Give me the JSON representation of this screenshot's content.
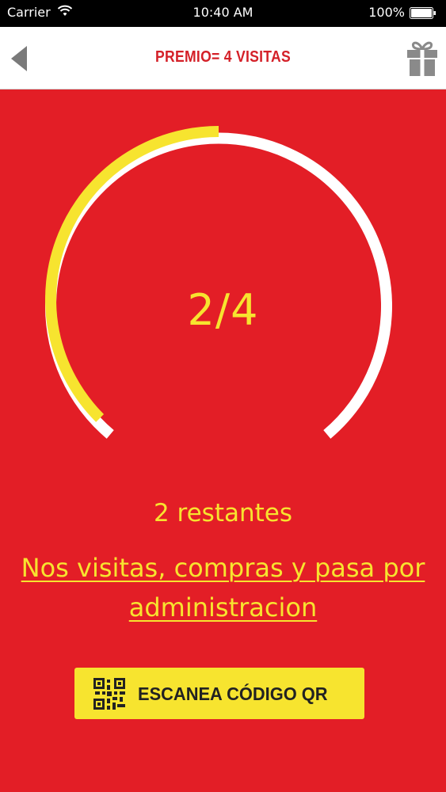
{
  "status_bar": {
    "carrier": "Carrier",
    "time": "10:40 AM",
    "battery": "100%"
  },
  "header": {
    "title": "PREMIO= 4 VISITAS",
    "back_icon": "back-arrow-icon",
    "gift_icon": "gift-icon"
  },
  "progress": {
    "label": "2/4",
    "completed": 2,
    "total": 4,
    "fraction": 0.5,
    "remaining_text": "2 restantes",
    "fill_color": "#f7e42f",
    "track_color": "#ffffff"
  },
  "instructions": {
    "line1": "Nos visitas, compras y pasa por",
    "line2": "administracion"
  },
  "scan_button": {
    "label": "ESCANEA CÓDIGO QR",
    "icon": "qr-code-icon"
  },
  "colors": {
    "background": "#e31e26",
    "accent": "#f7e42f",
    "title": "#d42028"
  }
}
